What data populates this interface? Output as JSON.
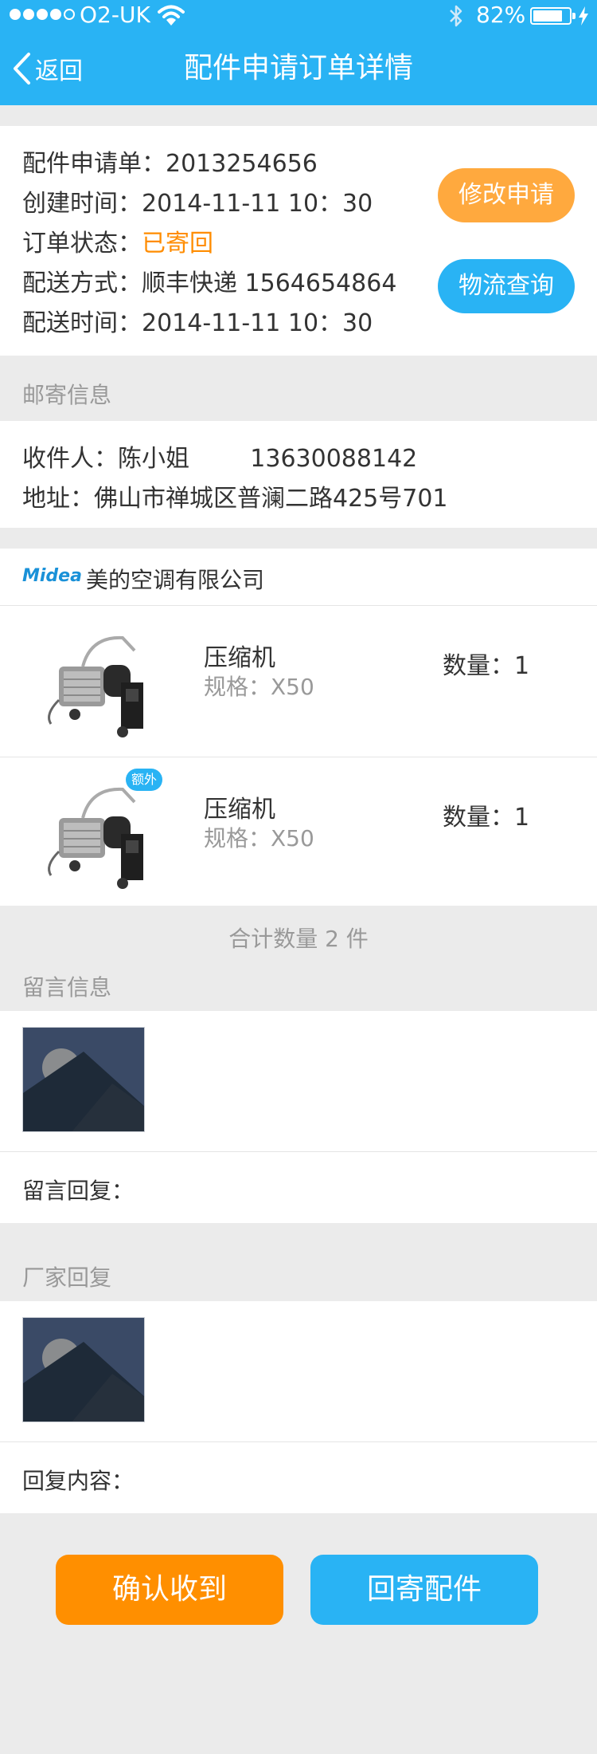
{
  "status_bar": {
    "carrier": "O2-UK",
    "battery_pct": "82%",
    "battery_level": 0.82,
    "signal_bars_filled": 4,
    "signal_bars_total": 5
  },
  "nav": {
    "back_label": "返回",
    "title": "配件申请订单详情"
  },
  "order": {
    "number_line": "配件申请单：2013254656",
    "created_line": "创建时间：2014-11-11  10：30",
    "status_label": "订单状态：",
    "status_value": "已寄回",
    "shipping_line": "配送方式：顺丰快递  1564654864",
    "delivery_line": "配送时间：2014-11-11  10：30",
    "modify_button": "修改申请",
    "track_button": "物流查询"
  },
  "mailing": {
    "section_label": "邮寄信息",
    "recipient_line": "收件人：陈小姐        13630088142",
    "address_line": "地址：佛山市禅城区普澜二路425号701"
  },
  "company": {
    "logo_text": "Midea",
    "name": "美的空调有限公司"
  },
  "products": [
    {
      "name": "压缩机",
      "spec": "规格：X50",
      "qty": "数量：1",
      "badge": ""
    },
    {
      "name": "压缩机",
      "spec": "规格：X50",
      "qty": "数量：1",
      "badge": "额外"
    }
  ],
  "total_text": "合计数量 2 件",
  "message": {
    "section_label": "留言信息",
    "reply_label": "留言回复："
  },
  "vendor": {
    "section_label": "厂家回复",
    "reply_label": "回复内容："
  },
  "actions": {
    "confirm_label": "确认收到",
    "return_label": "回寄配件"
  },
  "colors": {
    "brand_blue": "#29b3f4",
    "accent_orange": "#ff8f00",
    "status_orange": "#ff8c00"
  }
}
